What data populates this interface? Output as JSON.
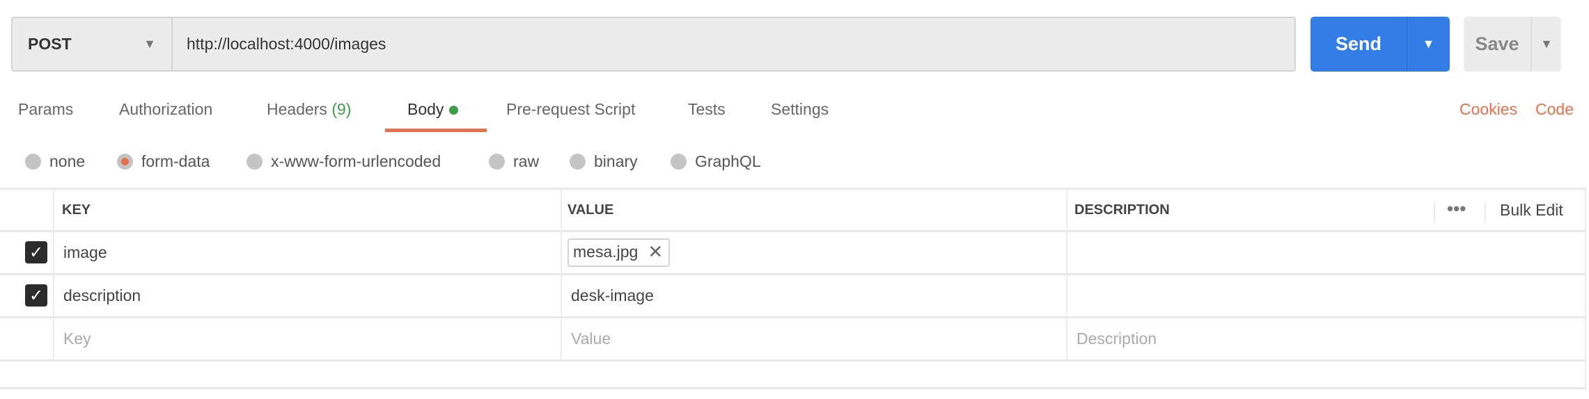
{
  "request": {
    "method": "POST",
    "url": "http://localhost:4000/images",
    "send_label": "Send",
    "save_label": "Save"
  },
  "tabs": [
    {
      "label": "Params"
    },
    {
      "label": "Authorization"
    },
    {
      "label": "Headers",
      "count": "(9)"
    },
    {
      "label": "Body",
      "active": true
    },
    {
      "label": "Pre-request Script"
    },
    {
      "label": "Tests"
    },
    {
      "label": "Settings"
    }
  ],
  "links": {
    "cookies": "Cookies",
    "code": "Code"
  },
  "body_types": [
    {
      "label": "none"
    },
    {
      "label": "form-data",
      "selected": true
    },
    {
      "label": "x-www-form-urlencoded"
    },
    {
      "label": "raw"
    },
    {
      "label": "binary"
    },
    {
      "label": "GraphQL"
    }
  ],
  "table": {
    "headers": {
      "key": "KEY",
      "value": "VALUE",
      "description": "DESCRIPTION",
      "bulk_edit": "Bulk Edit"
    },
    "rows": [
      {
        "checked": true,
        "key": "image",
        "value": "mesa.jpg",
        "value_type": "file",
        "description": ""
      },
      {
        "checked": true,
        "key": "description",
        "value": "desk-image",
        "description": ""
      }
    ],
    "placeholders": {
      "key": "Key",
      "value": "Value",
      "description": "Description"
    }
  },
  "colors": {
    "accent": "#e5704b",
    "send": "#337ee6",
    "active_dot": "#3f9e4b"
  }
}
